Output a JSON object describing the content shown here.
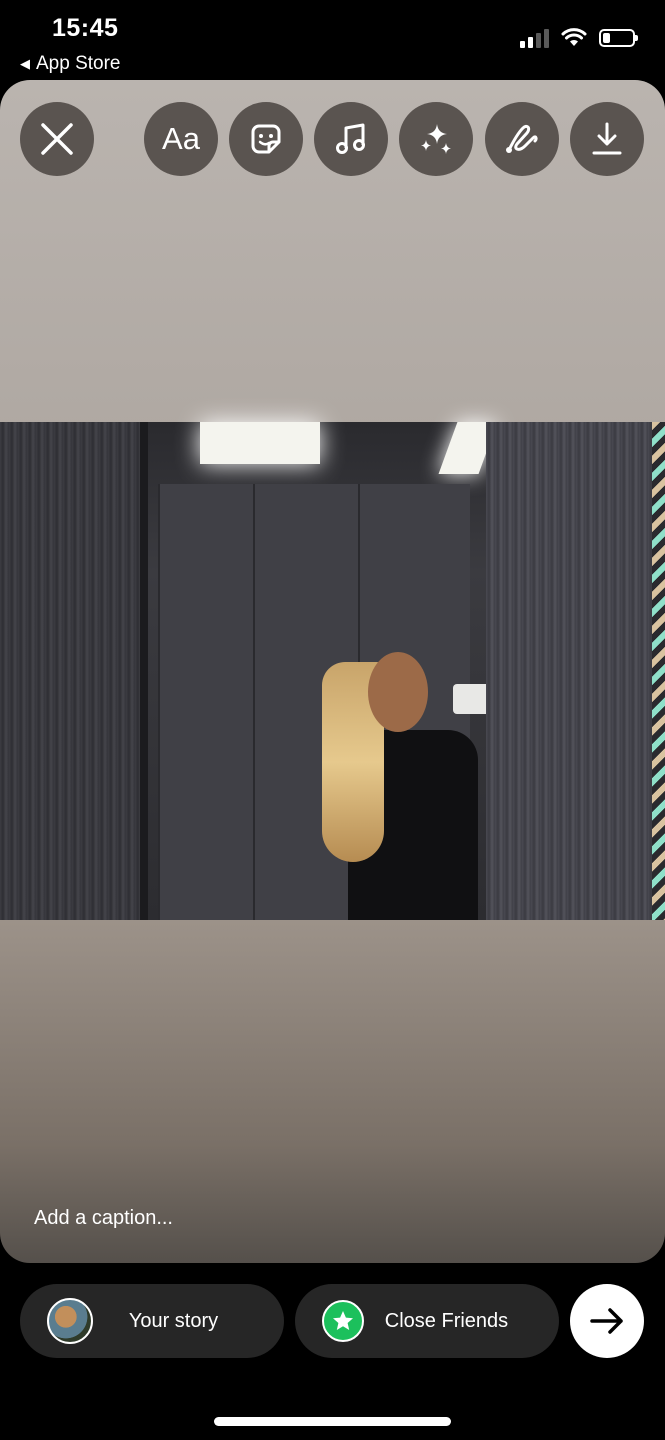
{
  "status_bar": {
    "time": "15:45",
    "back_label": "App Store",
    "icons": [
      "signal-icon",
      "wifi-icon",
      "battery-icon"
    ]
  },
  "toolbar": {
    "close": "close-icon",
    "text_label": "Aa",
    "tools": [
      "text-icon",
      "sticker-icon",
      "music-icon",
      "effects-icon",
      "draw-icon",
      "download-icon"
    ]
  },
  "caption": {
    "placeholder": "Add a caption..."
  },
  "share": {
    "your_story_label": "Your story",
    "close_friends_label": "Close Friends",
    "next": "arrow-right-icon"
  },
  "colors": {
    "accent_green": "#1cc05c",
    "pill_bg": "#262626"
  }
}
